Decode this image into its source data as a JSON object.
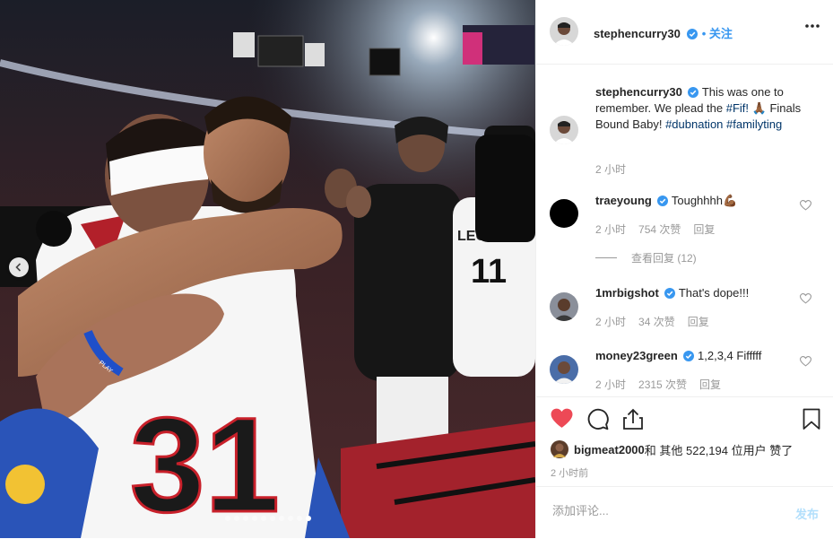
{
  "post": {
    "author": "stephencurry30",
    "follow_label": "• 关注",
    "caption_text": "This was one to remember. We plead the ",
    "caption_tag1": "#Fif!",
    "caption_mid": " 🙏🏾 Finals Bound Baby! ",
    "caption_tag2": "#dubnation",
    "caption_tag3": "#familyting",
    "caption_time": "2 小时",
    "photo_jersey_number": "31",
    "photo_jersey_number_bg": "11",
    "photo_jersey_name_bg": "LEO",
    "photo_wristband_text": "PLAY"
  },
  "comments": [
    {
      "user": "traeyoung",
      "text": "Toughhhh💪🏾",
      "time": "2 小时",
      "likes": "754 次赞",
      "reply": "回复",
      "view_replies": "查看回复 (12)"
    },
    {
      "user": "1mrbigshot",
      "text": "That's dope!!!",
      "time": "2 小时",
      "likes": "34 次赞",
      "reply": "回复"
    },
    {
      "user": "money23green",
      "text": "1,2,3,4 Fifffff",
      "time": "2 小时",
      "likes": "2315 次赞",
      "reply": "回复"
    }
  ],
  "likes_summary": {
    "user": "bigmeat2000",
    "rest": " 和 其他 522,194 位用户 赞了"
  },
  "posted_ago": "2 小时前",
  "composer": {
    "placeholder": "添加评论...",
    "post_label": "发布"
  },
  "carousel": {
    "count": 10,
    "active_index": 9
  },
  "colors": {
    "like_red": "#ed4956",
    "link_blue": "#3897f0",
    "hashtag": "#003569"
  },
  "icons": [
    "verified-icon",
    "more-options-icon",
    "heart-filled-icon",
    "comment-icon",
    "share-icon",
    "bookmark-icon",
    "small-heart-icon",
    "chevron-left-icon"
  ]
}
